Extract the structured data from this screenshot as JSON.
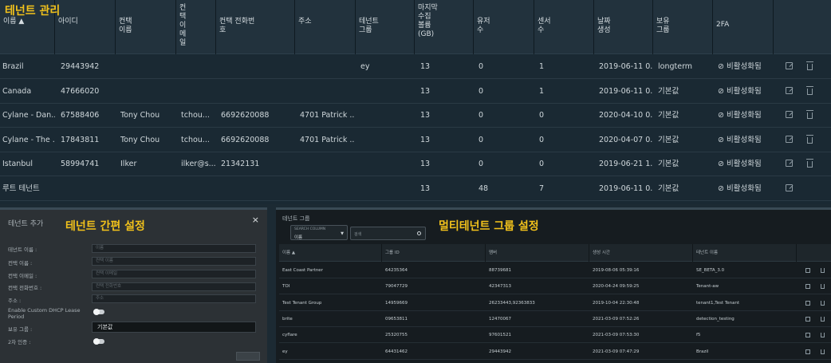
{
  "overlay_titles": {
    "tenant_management": "테넌트 관리",
    "tenant_quick_setup": "테넌트 간편 설정",
    "multi_tenant_group_setup": "멀티테넌트 그룹 설정"
  },
  "tenants_table": {
    "columns": [
      {
        "label": "이름 ▲"
      },
      {
        "label": "아이디"
      },
      {
        "label": "컨택\n이름"
      },
      {
        "label": "컨\n택\n이\n메\n일"
      },
      {
        "label": "컨택 전화번\n호"
      },
      {
        "label": "주소"
      },
      {
        "label": "테넌트\n그룹"
      },
      {
        "label": "마지막\n수집\n볼륨\n(GB)"
      },
      {
        "label": "유저\n수"
      },
      {
        "label": "센서\n수"
      },
      {
        "label": "날짜\n생성"
      },
      {
        "label": "보유\n그룹"
      },
      {
        "label": "2FA"
      }
    ],
    "rows": [
      {
        "name": "Brazil",
        "id": "29443942",
        "contact_name": "",
        "contact_email": "",
        "contact_phone": "",
        "address": "",
        "tenant_group": "ey",
        "last_volume": "13",
        "users": "0",
        "sensors": "1",
        "created": "2019-06-11 0...",
        "retention": "longterm",
        "twofa": "⊘ 비활성화됨",
        "deletable": true
      },
      {
        "name": "Canada",
        "id": "47666020",
        "contact_name": "",
        "contact_email": "",
        "contact_phone": "",
        "address": "",
        "tenant_group": "",
        "last_volume": "13",
        "users": "0",
        "sensors": "1",
        "created": "2019-06-11 0...",
        "retention": "기본값",
        "twofa": "⊘ 비활성화됨",
        "deletable": true
      },
      {
        "name": "Cylane - Dan...",
        "id": "67588406",
        "contact_name": "Tony Chou",
        "contact_email": "tchou...",
        "contact_phone": "6692620088",
        "address": "4701 Patrick ...",
        "tenant_group": "",
        "last_volume": "13",
        "users": "0",
        "sensors": "0",
        "created": "2020-04-10 0...",
        "retention": "기본값",
        "twofa": "⊘ 비활성화됨",
        "deletable": true
      },
      {
        "name": "Cylane - The ...",
        "id": "17843811",
        "contact_name": "Tony Chou",
        "contact_email": "tchou...",
        "contact_phone": "6692620088",
        "address": "4701 Patrick ...",
        "tenant_group": "",
        "last_volume": "13",
        "users": "0",
        "sensors": "0",
        "created": "2020-04-07 0...",
        "retention": "기본값",
        "twofa": "⊘ 비활성화됨",
        "deletable": true
      },
      {
        "name": "Istanbul",
        "id": "58994741",
        "contact_name": "Ilker",
        "contact_email": "ilker@s...",
        "contact_phone": "21342131",
        "address": "",
        "tenant_group": "",
        "last_volume": "13",
        "users": "0",
        "sensors": "0",
        "created": "2019-06-21 1...",
        "retention": "기본값",
        "twofa": "⊘ 비활성화됨",
        "deletable": true
      },
      {
        "name": "루트 테넌트",
        "id": "",
        "contact_name": "",
        "contact_email": "",
        "contact_phone": "",
        "address": "",
        "tenant_group": "",
        "last_volume": "13",
        "users": "48",
        "sensors": "7",
        "created": "2019-06-11 0...",
        "retention": "기본값",
        "twofa": "⊘ 비활성화됨",
        "deletable": false
      }
    ]
  },
  "add_tenant_dialog": {
    "title": "테넌트 추가",
    "close": "×",
    "fields": [
      {
        "label": "테넌트 이름 :",
        "placeholder": "이름"
      },
      {
        "label": "컨택 이름 :",
        "placeholder": "컨택 이름"
      },
      {
        "label": "컨택 이메일 :",
        "placeholder": "컨택 이메일"
      },
      {
        "label": "컨택 전화번호 :",
        "placeholder": "컨택 전화번호"
      },
      {
        "label": "주소 :",
        "placeholder": "주소"
      }
    ],
    "dhcp_label": "Enable Custom DHCP Lease\nPeriod",
    "retention_label": "보유 그룹 :",
    "retention_value": "기본값",
    "twofa_label": "2차 인증 :"
  },
  "tenant_groups": {
    "title": "테넌트 그룹",
    "search_column_label": "SEARCH COLUMN",
    "search_column_value": "이름",
    "search_placeholder": "검색",
    "columns": [
      "이름 ▲",
      "그룹 ID",
      "멤버",
      "생성 시간",
      "테넌트 이름"
    ],
    "rows": [
      {
        "name": "East Coast Partner",
        "group_id": "64235364",
        "members": "88739681",
        "created": "2019-08-06 05:39:16",
        "tenants": "SE_BETA_3.0"
      },
      {
        "name": "TOI",
        "group_id": "79047729",
        "members": "42347313",
        "created": "2020-04-24 09:59:25",
        "tenants": "Tenant-aw"
      },
      {
        "name": "Test Tenant Group",
        "group_id": "14959669",
        "members": "26233443,92363833",
        "created": "2019-10-04 22:30:48",
        "tenants": "tenant1,Test Tenant"
      },
      {
        "name": "brite",
        "group_id": "09653811",
        "members": "12470067",
        "created": "2021-03-09 07:52:26",
        "tenants": "detection_testing"
      },
      {
        "name": "cyflare",
        "group_id": "25320755",
        "members": "97601521",
        "created": "2021-03-09 07:53:30",
        "tenants": "f5"
      },
      {
        "name": "ey",
        "group_id": "64431462",
        "members": "29443942",
        "created": "2021-03-09 07:47:29",
        "tenants": "Brazil"
      }
    ]
  }
}
